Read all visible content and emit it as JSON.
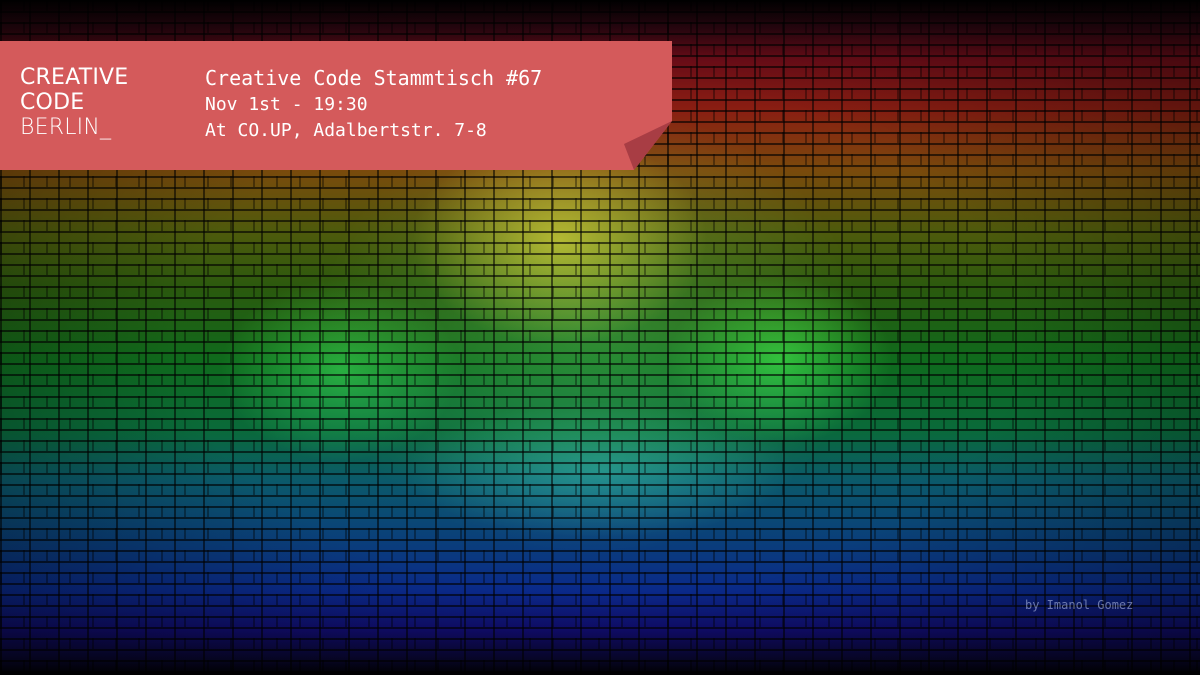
{
  "logo": {
    "line1": "CREATIVE",
    "line2": "CODE",
    "line3": "BERLIN_"
  },
  "event": {
    "title": "Creative Code Stammtisch #67",
    "date": "Nov 1st - 19:30",
    "venue": "At CO.UP, Adalbertstr. 7-8"
  },
  "credit": "by Imanol Gomez",
  "colors": {
    "banner": "#d45a5b",
    "banner_fold": "#a83d44",
    "text": "#ffffff"
  }
}
